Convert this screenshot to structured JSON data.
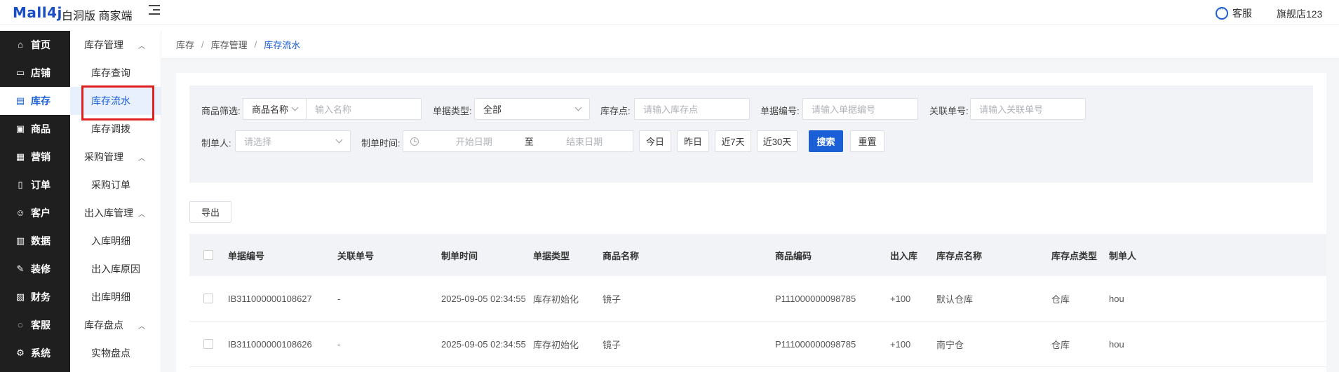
{
  "header": {
    "logo": "Mall4j",
    "subtitle": "白洞版 商家端",
    "service_label": "客服",
    "store_name": "旗舰店123"
  },
  "sidebar": {
    "items": [
      {
        "label": "首页",
        "icon": "home-icon",
        "glyph": "⌂"
      },
      {
        "label": "店铺",
        "icon": "shop-icon",
        "glyph": "▭"
      },
      {
        "label": "库存",
        "icon": "inventory-icon",
        "glyph": "▤",
        "active": true
      },
      {
        "label": "商品",
        "icon": "product-icon",
        "glyph": "▣"
      },
      {
        "label": "营销",
        "icon": "gift-icon",
        "glyph": "▦"
      },
      {
        "label": "订单",
        "icon": "order-icon",
        "glyph": "▯"
      },
      {
        "label": "客户",
        "icon": "user-icon",
        "glyph": "☺"
      },
      {
        "label": "数据",
        "icon": "chart-icon",
        "glyph": "▥"
      },
      {
        "label": "装修",
        "icon": "decorate-icon",
        "glyph": "✎"
      },
      {
        "label": "财务",
        "icon": "finance-icon",
        "glyph": "▧"
      },
      {
        "label": "客服",
        "icon": "chat-icon",
        "glyph": "◌"
      },
      {
        "label": "系统",
        "icon": "settings-icon",
        "glyph": "⚙"
      }
    ]
  },
  "subnav": [
    {
      "type": "group",
      "label": "库存管理"
    },
    {
      "type": "item",
      "label": "库存查询"
    },
    {
      "type": "item",
      "label": "库存流水",
      "active": true
    },
    {
      "type": "item",
      "label": "库存调拨"
    },
    {
      "type": "group",
      "label": "采购管理"
    },
    {
      "type": "item",
      "label": "采购订单"
    },
    {
      "type": "group",
      "label": "出入库管理"
    },
    {
      "type": "item",
      "label": "入库明细"
    },
    {
      "type": "item",
      "label": "出入库原因"
    },
    {
      "type": "item",
      "label": "出库明细"
    },
    {
      "type": "group",
      "label": "库存盘点"
    },
    {
      "type": "item",
      "label": "实物盘点"
    }
  ],
  "breadcrumb": [
    "库存",
    "库存管理",
    "库存流水"
  ],
  "filters": {
    "product_filter_label": "商品筛选:",
    "product_filter_select": "商品名称",
    "product_name_placeholder": "输入名称",
    "doc_type_label": "单据类型:",
    "doc_type_value": "全部",
    "stock_point_label": "库存点:",
    "stock_point_placeholder": "请输入库存点",
    "doc_no_label": "单据编号:",
    "doc_no_placeholder": "请输入单据编号",
    "related_no_label": "关联单号:",
    "related_no_placeholder": "请输入关联单号",
    "creator_label": "制单人:",
    "creator_placeholder": "请选择",
    "time_label": "制单时间:",
    "start_placeholder": "开始日期",
    "range_sep": "至",
    "end_placeholder": "结束日期",
    "today": "今日",
    "yesterday": "昨日",
    "last7": "近7天",
    "last30": "近30天",
    "search": "搜索",
    "reset": "重置"
  },
  "export_label": "导出",
  "table": {
    "columns": [
      "单据编号",
      "关联单号",
      "制单时间",
      "单据类型",
      "商品名称",
      "商品编码",
      "出入库",
      "库存点名称",
      "库存点类型",
      "制单人"
    ],
    "rows": [
      [
        "IB311000000108627",
        "-",
        "2025-09-05 02:34:55",
        "库存初始化",
        "镜子",
        "P111000000098785",
        "+100",
        "默认仓库",
        "仓库",
        "hou"
      ],
      [
        "IB311000000108626",
        "-",
        "2025-09-05 02:34:55",
        "库存初始化",
        "镜子",
        "P111000000098785",
        "+100",
        "南宁仓",
        "仓库",
        "hou"
      ]
    ]
  }
}
